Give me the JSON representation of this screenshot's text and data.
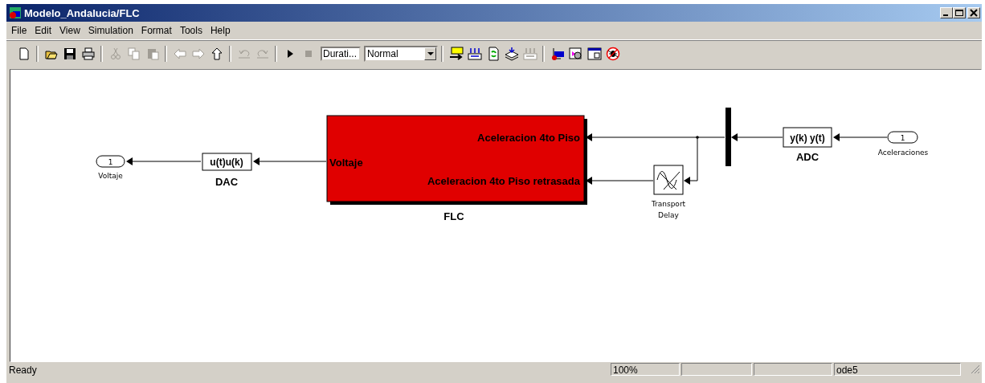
{
  "window": {
    "title": "Modelo_Andalucia/FLC"
  },
  "menu": [
    "File",
    "Edit",
    "View",
    "Simulation",
    "Format",
    "Tools",
    "Help"
  ],
  "toolbar": {
    "groups": [
      [
        {
          "kind": "new",
          "disabled": false
        }
      ],
      [
        {
          "kind": "open",
          "disabled": false
        },
        {
          "kind": "save",
          "disabled": false
        },
        {
          "kind": "print",
          "disabled": false
        }
      ],
      [
        {
          "kind": "cut",
          "disabled": true
        },
        {
          "kind": "copy",
          "disabled": true
        },
        {
          "kind": "paste",
          "disabled": true
        }
      ],
      [
        {
          "kind": "back",
          "disabled": true
        },
        {
          "kind": "forward",
          "disabled": true
        },
        {
          "kind": "up",
          "disabled": false
        }
      ],
      [
        {
          "kind": "undo",
          "disabled": true
        },
        {
          "kind": "redo",
          "disabled": true
        }
      ],
      [
        {
          "kind": "play",
          "disabled": false
        },
        {
          "kind": "stop",
          "disabled": true
        }
      ]
    ],
    "stop_time": "Durati...",
    "mode": "Normal",
    "tools": [
      [
        {
          "kind": "chart",
          "disabled": false
        },
        {
          "kind": "grid",
          "disabled": false
        },
        {
          "kind": "doc",
          "disabled": false
        },
        {
          "kind": "stack",
          "disabled": false
        },
        {
          "kind": "grid",
          "disabled": true
        }
      ],
      [
        {
          "kind": "block",
          "disabled": false
        },
        {
          "kind": "viewer",
          "disabled": false
        },
        {
          "kind": "window",
          "disabled": false
        },
        {
          "kind": "bug",
          "disabled": false
        }
      ]
    ]
  },
  "diagram": {
    "outport": {
      "number": "1",
      "label": "Voltaje"
    },
    "dac": {
      "text": "u(t)u(k)",
      "label": "DAC"
    },
    "flc": {
      "input": "Voltaje",
      "outputs": [
        "Aceleracion 4to Piso",
        "Aceleracion 4to Piso retrasada"
      ],
      "label": "FLC"
    },
    "delay": {
      "label_lines": [
        "Transport",
        "Delay"
      ]
    },
    "adc": {
      "text": "y(k) y(t)",
      "label": "ADC"
    },
    "inport": {
      "number": "1",
      "label": "Aceleraciones"
    }
  },
  "status_bar": {
    "message": "Ready",
    "zoom": "100%",
    "solver": "ode5"
  }
}
